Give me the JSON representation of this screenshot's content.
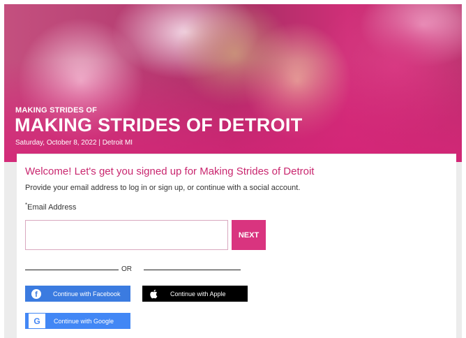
{
  "hero": {
    "eyebrow": "MAKING STRIDES OF",
    "title": "MAKING STRIDES OF DETROIT",
    "subtitle": "Saturday, October 8, 2022 | Detroit MI"
  },
  "signup": {
    "welcome": "Welcome! Let's get you signed up for Making Strides of Detroit",
    "instructions": "Provide your email address to log in or sign up, or continue with a social account.",
    "email_label_required_mark": "*",
    "email_label": "Email Address",
    "email_value": "",
    "email_placeholder": "",
    "next_label": "NEXT",
    "or_label": "OR"
  },
  "social": {
    "facebook_label": "Continue with Facebook",
    "apple_label": "Continue with Apple",
    "google_label": "Continue with Google",
    "facebook_icon_glyph": "f",
    "google_icon_glyph": "G"
  },
  "colors": {
    "accent": "#d9347f",
    "heading": "#c9276f",
    "facebook": "#3b7be0",
    "apple": "#000000",
    "google": "#4287f5"
  }
}
